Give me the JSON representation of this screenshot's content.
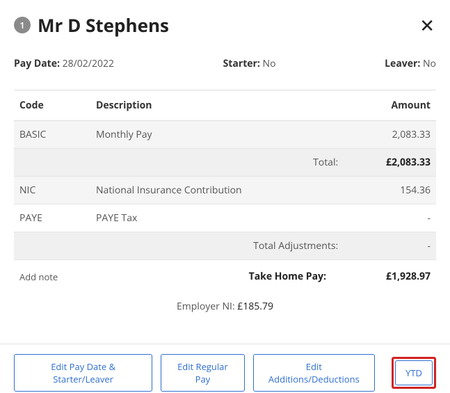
{
  "header": {
    "badge": "1",
    "title": "Mr D Stephens"
  },
  "meta": {
    "pay_date_label": "Pay Date:",
    "pay_date_value": "28/02/2022",
    "starter_label": "Starter:",
    "starter_value": "No",
    "leaver_label": "Leaver:",
    "leaver_value": "No"
  },
  "table": {
    "head_code": "Code",
    "head_desc": "Description",
    "head_amount": "Amount",
    "rows": [
      {
        "code": "BASIC",
        "desc": "Monthly Pay",
        "amount": "2,083.33",
        "shaded": true
      }
    ],
    "total_label": "Total:",
    "total_value": "£2,083.33",
    "adj_rows": [
      {
        "code": "NIC",
        "desc": "National Insurance Contribution",
        "amount": "154.36",
        "shaded": true
      },
      {
        "code": "PAYE",
        "desc": "PAYE Tax",
        "amount": "-",
        "shaded": false
      }
    ],
    "adj_total_label": "Total Adjustments:",
    "adj_total_value": "-"
  },
  "take_home": {
    "add_note": "Add note",
    "label": "Take Home Pay:",
    "value": "£1,928.97"
  },
  "employer_ni": {
    "label": "Employer NI: ",
    "value": "£185.79"
  },
  "footer": {
    "edit_pay_date": "Edit Pay Date & Starter/Leaver",
    "edit_regular": "Edit Regular Pay",
    "edit_add_ded": "Edit Additions/Deductions",
    "ytd": "YTD"
  }
}
